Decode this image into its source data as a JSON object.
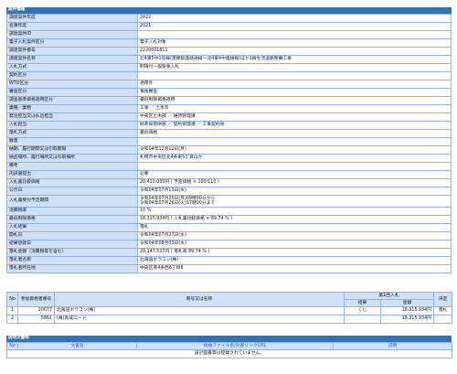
{
  "case_section_title": "案件情報",
  "rows": [
    {
      "label": "調達案件年度",
      "value": "2022"
    },
    {
      "label": "名簿年度",
      "value": "2021"
    },
    {
      "label": "調達案件ID",
      "value": ""
    },
    {
      "label": "電子入札案件区分",
      "value": "電子入札対象"
    },
    {
      "label": "調達案件番号",
      "value": "2220001811"
    },
    {
      "label": "調達案件名称",
      "value": "北4東5中1号線(苗穂駅連絡通線～北4東4中連絡線)ほか1線生活道路整備工事"
    },
    {
      "label": "入札方式",
      "value": "制限付一般競争入札"
    },
    {
      "label": "契約区分",
      "value": ""
    },
    {
      "label": "WTO区分",
      "value": "適用外"
    },
    {
      "label": "審査区分",
      "value": "事後審査"
    },
    {
      "label": "調査基準価格適用区分",
      "value": "最低制限価格適用"
    },
    {
      "label": "業種／業務",
      "value": "工事 ／ 土木Ｂ"
    },
    {
      "label": "発注担当又は払出担当",
      "value": "中央区土木部 ／ 維持管理課"
    },
    {
      "label": "入札担当",
      "value": "財政局管財部 ／ 契約管理課 ／ 工事契約係"
    },
    {
      "label": "落札方式",
      "value": "最低価格"
    },
    {
      "label": "数量",
      "value": ""
    },
    {
      "label": "納期、履行期間又は引取期限",
      "value": "令和04年12月12日(月)"
    },
    {
      "label": "納品場所、履行場所又は引取場所",
      "value": "札幌市中央区北4条東5丁目ほか"
    },
    {
      "label": "備考",
      "value": ""
    },
    {
      "label": "内訳書提出",
      "value": "必要"
    },
    {
      "label": "入札書比較価格",
      "value": "20,410,000円 ( 予定価格 × 100/110 )"
    },
    {
      "label": "公示日",
      "value": "令和04年07月13日(水)"
    },
    {
      "label": "入札書受付予定期間",
      "value": "令和04年07月25日(月)09時00分から\n令和04年07月26日(火)17時00分まで"
    },
    {
      "label": "消費税率",
      "value": "10 %"
    },
    {
      "label": "最低制限価格",
      "value": "18,315,934円 ( 入札書比較価格 × 89.74 % )"
    },
    {
      "label": "入札結果",
      "value": "落札"
    },
    {
      "label": "開札日",
      "value": "令和04年07月27日(水)"
    },
    {
      "label": "結果登録日",
      "value": "令和04年08月03日(水)"
    },
    {
      "label": "落札金額（消費税等を含む）",
      "value": "20,147,527円 ( 落札率 89.74 % )"
    },
    {
      "label": "落札者名称",
      "value": "北海道ボラコン(株)"
    },
    {
      "label": "落札者所在地",
      "value": "中央区南4条西6丁目8"
    }
  ],
  "bidders": {
    "headers": {
      "no": "No",
      "reg_no": "参加資格者番号",
      "name": "商号又は名称",
      "round1": "第1回入札",
      "result": "結果",
      "amount": "金額",
      "decision": "決定"
    },
    "rows": [
      {
        "no": "1",
        "reg_no": "20677",
        "name": "北海道ボラコン(株)",
        "result": "くじ",
        "amount": "18,315,934円",
        "decision": "落札"
      },
      {
        "no": "2",
        "reg_no": "5861",
        "name": "(株)真成ロード",
        "result": "",
        "amount": "18,315,934円",
        "decision": ""
      }
    ]
  },
  "docs": {
    "title": "説明文書等",
    "headers": {
      "no": "No",
      "doc_name": "文書名",
      "file_link": "格納ファイル名/外部リンクURL",
      "description": "説明"
    },
    "empty_message": "設計図書等は登録されていません。"
  },
  "colors": {
    "header_bg": "#2f73b8",
    "label_bg": "#cfe0f7",
    "border": "#8fb3e6",
    "link_text": "#2e5aa8"
  }
}
